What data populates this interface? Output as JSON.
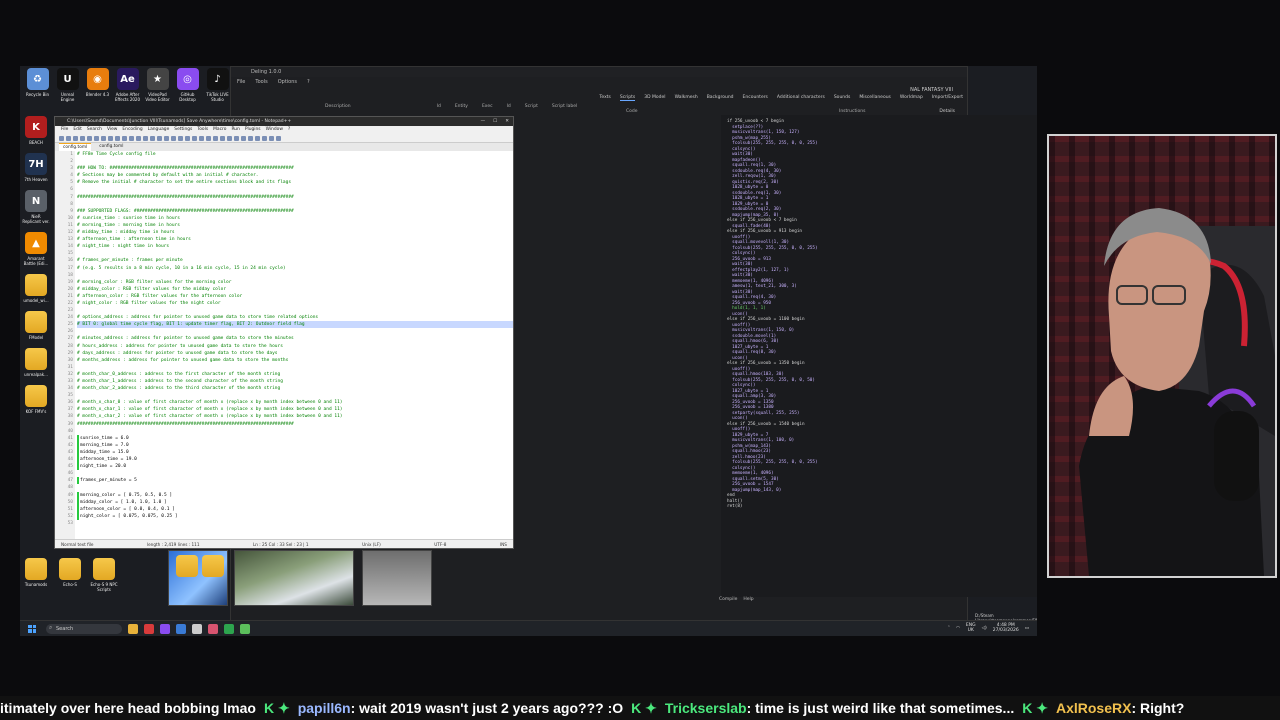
{
  "desktop": {
    "top_apps": [
      {
        "label": "Recycle Bin",
        "icon": "recycle-bin-icon",
        "color": "#5c8fd6",
        "glyph": "♻"
      },
      {
        "label": "Unreal Engine",
        "icon": "unreal-engine-icon",
        "color": "#111111",
        "glyph": "U"
      },
      {
        "label": "Blender 4.3",
        "icon": "blender-icon",
        "color": "#e87d0d",
        "glyph": "◉"
      },
      {
        "label": "Adobe After Effects 2020",
        "icon": "after-effects-icon",
        "color": "#2a1a5e",
        "glyph": "Ae"
      },
      {
        "label": "VideoPad Video Editor",
        "icon": "videopad-icon",
        "color": "#444444",
        "glyph": "★"
      },
      {
        "label": "GitHub Desktop",
        "icon": "github-icon",
        "color": "#8a4cf0",
        "glyph": "◎"
      },
      {
        "label": "TikTok LIVE Studio",
        "icon": "tiktok-icon",
        "color": "#111111",
        "glyph": "♪"
      }
    ],
    "left_icons": [
      {
        "label": "BEACH",
        "icon": "beach-app-icon",
        "color": "#b21e1e",
        "glyph": "K"
      },
      {
        "label": "7th Heaven",
        "icon": "seventh-heaven-icon",
        "color": "#20324f",
        "glyph": "7H"
      },
      {
        "label": "NieR Replicant ver.",
        "icon": "nier-icon",
        "color": "#5a6068",
        "glyph": "N"
      },
      {
        "label": "Amarant Battle (Edi...",
        "icon": "vlc-icon",
        "color": "#f08a00",
        "glyph": "▲"
      },
      {
        "label": "umodel_wi...",
        "icon": "folder-icon",
        "color": "folder",
        "glyph": ""
      },
      {
        "label": "FModel",
        "icon": "folder-icon",
        "color": "folder",
        "glyph": ""
      },
      {
        "label": "unrealpak...",
        "icon": "folder-icon",
        "color": "folder",
        "glyph": ""
      },
      {
        "label": "KOF FMV's",
        "icon": "folder-icon",
        "color": "folder",
        "glyph": ""
      }
    ],
    "bottom_icons": [
      {
        "label": "Tsunamods",
        "icon": "folder-icon"
      },
      {
        "label": "Echo-S",
        "icon": "folder-icon"
      },
      {
        "label": "Echo-S 9 NPC Scripts",
        "icon": "folder-icon"
      }
    ]
  },
  "toolwin": {
    "title": "Deling 1.0.0",
    "menu": [
      "File",
      "Tools",
      "Options",
      "?"
    ],
    "tabs": [
      "Texts",
      "Scripts",
      "3D Model",
      "Walkmesh",
      "Background",
      "Encounters",
      "Additional characters",
      "Sounds",
      "Miscellaneous",
      "Worldmap",
      "Import/Export"
    ],
    "active_tab": "Scripts",
    "right_title": "NAL FANTASY VIII",
    "column_headers": [
      "Description",
      "Id",
      "Entity",
      "Exec",
      "Id",
      "Script",
      "Script label"
    ],
    "code_header": "Code",
    "instructions_header": "Instructions",
    "details_label": "Details",
    "status_tabs": [
      "Compile",
      "Help"
    ],
    "path": "D:/Steam Library/steamapps/common/FINAL FANTASY VIII/Data/lang-en/field/fi"
  },
  "code_lines": [
    {
      "t": "if 256_uvoob < 7 begin",
      "c": "kw"
    },
    {
      "t": "  setplace(??)",
      "c": ""
    },
    {
      "t": "  musicvoltrans(1, 150, 127)",
      "c": ""
    },
    {
      "t": "  pshm_w(map_255)",
      "c": ""
    },
    {
      "t": "  fcolsub(255, 255, 255, 0, 0, 255)",
      "c": ""
    },
    {
      "t": "  colsync()",
      "c": ""
    },
    {
      "t": "  wait(30)",
      "c": ""
    },
    {
      "t": "  mapfadeon()",
      "c": ""
    },
    {
      "t": "  squall.req(1, 30)",
      "c": ""
    },
    {
      "t": "  ssdouble.req(4, 30)",
      "c": ""
    },
    {
      "t": "  zell.reqsw(1, 30)",
      "c": ""
    },
    {
      "t": "  quistis.req(2, 30)",
      "c": ""
    },
    {
      "t": "  1028_ubyte = 0",
      "c": ""
    },
    {
      "t": "  ssdouble.req(1, 30)",
      "c": ""
    },
    {
      "t": "  1028_ubyte = 1",
      "c": ""
    },
    {
      "t": "  1029_ubyte = 0",
      "c": ""
    },
    {
      "t": "  ssdouble.req(2, 30)",
      "c": ""
    },
    {
      "t": "  mapjump(map_35, 0)",
      "c": ""
    },
    {
      "t": "else if 256_uvoob < 7 begin",
      "c": "kw"
    },
    {
      "t": "  squall.fade(40)",
      "c": ""
    },
    {
      "t": "else if 256_uvoob = 913 begin",
      "c": "kw"
    },
    {
      "t": "  uooff()",
      "c": ""
    },
    {
      "t": "  squall.movevoll(1, 30)",
      "c": ""
    },
    {
      "t": "  fcolsub(255, 255, 255, 0, 0, 255)",
      "c": ""
    },
    {
      "t": "  colsync()",
      "c": ""
    },
    {
      "t": "  256_uvoob = 913",
      "c": ""
    },
    {
      "t": "  wait(30)",
      "c": ""
    },
    {
      "t": "  effectplay2(1, 127, 1)",
      "c": ""
    },
    {
      "t": "  wait(30)",
      "c": ""
    },
    {
      "t": "  memoeme(1, 4096)",
      "c": ""
    },
    {
      "t": "  amesw(1, text_21, 300, 3)",
      "c": ""
    },
    {
      "t": "  wait(30)",
      "c": ""
    },
    {
      "t": "  squall.req(4, 30)",
      "c": ""
    },
    {
      "t": "  256_uvoob = 950",
      "c": ""
    },
    {
      "t": "  hold(1, 1, 1)",
      "c": "ok"
    },
    {
      "t": "  ucon()",
      "c": ""
    },
    {
      "t": "else if 256_uvoob = 1100 begin",
      "c": "kw"
    },
    {
      "t": "  uooff()",
      "c": ""
    },
    {
      "t": "  musicvoltrans(1, 150, 0)",
      "c": ""
    },
    {
      "t": "  ssdouble.movel(1)",
      "c": ""
    },
    {
      "t": "  squall.hmoo(6, 30)",
      "c": ""
    },
    {
      "t": "  1027_ubyte = 1",
      "c": ""
    },
    {
      "t": "  squall.req(8, 30)",
      "c": ""
    },
    {
      "t": "  ucon()",
      "c": ""
    },
    {
      "t": "else if 256_uvoob = 1350 begin",
      "c": "kw"
    },
    {
      "t": "  uooff()",
      "c": ""
    },
    {
      "t": "  squall.hmoo(103, 30)",
      "c": ""
    },
    {
      "t": "  fcolsub(255, 255, 255, 0, 0, 50)",
      "c": ""
    },
    {
      "t": "  colsync()",
      "c": ""
    },
    {
      "t": "  1027_ubyte = 1",
      "c": ""
    },
    {
      "t": "  squall.amp(3, 30)",
      "c": ""
    },
    {
      "t": "  256_uvoob = 1350",
      "c": ""
    },
    {
      "t": "  256_uvoob = 1380",
      "c": ""
    },
    {
      "t": "  setparty(squall, 255, 255)",
      "c": ""
    },
    {
      "t": "  ucon()",
      "c": ""
    },
    {
      "t": "else if 256_uvoob = 1540 begin",
      "c": "kw"
    },
    {
      "t": "  uooff()",
      "c": ""
    },
    {
      "t": "  1029_ubyte = 7",
      "c": ""
    },
    {
      "t": "  musicvoltrans(1, 100, 0)",
      "c": ""
    },
    {
      "t": "  pshm_w(map_143)",
      "c": ""
    },
    {
      "t": "  squall.hmoo(23)",
      "c": ""
    },
    {
      "t": "  zell.hmoo(23)",
      "c": ""
    },
    {
      "t": "  fcolsub(255, 255, 255, 0, 0, 255)",
      "c": ""
    },
    {
      "t": "  colsync()",
      "c": ""
    },
    {
      "t": "  memoeme(1, 4096)",
      "c": ""
    },
    {
      "t": "  squall.setm(5, 30)",
      "c": ""
    },
    {
      "t": "  256_uvoob = 1547",
      "c": ""
    },
    {
      "t": "  mapjump(map_143, 0)",
      "c": ""
    },
    {
      "t": "end",
      "c": "kw"
    },
    {
      "t": "halt()",
      "c": "kw"
    },
    {
      "t": "ret(8)",
      "c": "kw"
    }
  ],
  "npp": {
    "title": "C:\\Users\\Sound\\Documents\\Junction VIII\\Tsunamods] Save Anywhere\\time\\config.toml - Notepad++",
    "menu": [
      "File",
      "Edit",
      "Search",
      "View",
      "Encoding",
      "Language",
      "Settings",
      "Tools",
      "Macro",
      "Run",
      "Plugins",
      "Window",
      "?"
    ],
    "tabs": [
      "config.toml",
      "config.toml"
    ],
    "status": {
      "type": "Normal text file",
      "length": "length : 2,419    lines : 111",
      "position": "Ln : 25    Col : 33    Sel : 23 | 1",
      "eol": "Unix (LF)",
      "encoding": "UTF-8",
      "mode": "INS"
    },
    "lines": [
      {
        "n": "1",
        "t": "# FF8e Time Cycle config file",
        "c": ""
      },
      {
        "n": "2",
        "t": "",
        "c": ""
      },
      {
        "n": "3",
        "t": "### HOW TO: ####################################################################",
        "c": ""
      },
      {
        "n": "4",
        "t": "# Sections may be commented by default with an initial # character.",
        "c": ""
      },
      {
        "n": "5",
        "t": "# Remove the initial # character to set the entire sections block and its flags",
        "c": ""
      },
      {
        "n": "6",
        "t": "",
        "c": ""
      },
      {
        "n": "7",
        "t": "################################################################################",
        "c": ""
      },
      {
        "n": "8",
        "t": "",
        "c": ""
      },
      {
        "n": "9",
        "t": "### SUPPORTED FLAGS: ###########################################################",
        "c": ""
      },
      {
        "n": "10",
        "t": "# sunrise_time : sunrise time in hours",
        "c": ""
      },
      {
        "n": "11",
        "t": "# morning_time : morning time in hours",
        "c": ""
      },
      {
        "n": "12",
        "t": "# midday_time : midday time in hours",
        "c": ""
      },
      {
        "n": "13",
        "t": "# afternoon_time : afternoon time in hours",
        "c": ""
      },
      {
        "n": "14",
        "t": "# night_time : night time in hours",
        "c": ""
      },
      {
        "n": "15",
        "t": "",
        "c": ""
      },
      {
        "n": "16",
        "t": "# frames_per_minute : frames per minute",
        "c": ""
      },
      {
        "n": "17",
        "t": "# (e.g. 5 results in a 8 min cycle, 10 in a 16 min cycle, 15 in 24 min cycle)",
        "c": ""
      },
      {
        "n": "18",
        "t": "",
        "c": ""
      },
      {
        "n": "19",
        "t": "# morning_color : RGB filter values for the morning color",
        "c": ""
      },
      {
        "n": "20",
        "t": "# midday_color : RGB filter values for the midday color",
        "c": ""
      },
      {
        "n": "21",
        "t": "# afternoon_color : RGB filter values for the afternoon color",
        "c": ""
      },
      {
        "n": "22",
        "t": "# night_color : RGB filter values for the night color",
        "c": ""
      },
      {
        "n": "23",
        "t": "",
        "c": ""
      },
      {
        "n": "24",
        "t": "# options_address : address for pointer to unused game data to store time related options",
        "c": ""
      },
      {
        "n": "25",
        "t": "# BIT 0: global time cycle flag, BIT 1: update timer flag, BIT 2: Outdoor field flag",
        "c": "hl"
      },
      {
        "n": "26",
        "t": "",
        "c": ""
      },
      {
        "n": "27",
        "t": "# minutes_address : address for pointer to unused game data to store the minutes",
        "c": ""
      },
      {
        "n": "28",
        "t": "# hours_address : address for pointer to unused game data to store the hours",
        "c": ""
      },
      {
        "n": "29",
        "t": "# days_address : address for pointer to unused game data to store the days",
        "c": ""
      },
      {
        "n": "30",
        "t": "# months_address : address for pointer to unused game data to store the months",
        "c": ""
      },
      {
        "n": "31",
        "t": "",
        "c": ""
      },
      {
        "n": "32",
        "t": "# month_char_0_address : address to the first character of the month string",
        "c": ""
      },
      {
        "n": "33",
        "t": "# month_char_1_address : address to the second character of the month string",
        "c": ""
      },
      {
        "n": "34",
        "t": "# month_char_2_address : address to the third character of the month string",
        "c": ""
      },
      {
        "n": "35",
        "t": "",
        "c": ""
      },
      {
        "n": "36",
        "t": "# month_x_char_0 : value of first character of month x (replace x by month index between 0 and 11)",
        "c": ""
      },
      {
        "n": "37",
        "t": "# month_x_char_1 : value of first character of month x (replace x by month index between 0 and 11)",
        "c": ""
      },
      {
        "n": "38",
        "t": "# month_x_char_2 : value of first character of month x (replace x by month index between 0 and 11)",
        "c": ""
      },
      {
        "n": "39",
        "t": "################################################################################",
        "c": ""
      },
      {
        "n": "40",
        "t": "",
        "c": ""
      },
      {
        "n": "41",
        "t": "sunrise_time = 6.0",
        "c": "code bar"
      },
      {
        "n": "42",
        "t": "morning_time = 7.0",
        "c": "code bar"
      },
      {
        "n": "43",
        "t": "midday_time = 15.0",
        "c": "code bar"
      },
      {
        "n": "44",
        "t": "afternoon_time = 19.0",
        "c": "code bar"
      },
      {
        "n": "45",
        "t": "night_time = 20.0",
        "c": "code bar"
      },
      {
        "n": "46",
        "t": "",
        "c": ""
      },
      {
        "n": "47",
        "t": "frames_per_minute = 5",
        "c": "code bar"
      },
      {
        "n": "48",
        "t": "",
        "c": ""
      },
      {
        "n": "49",
        "t": "morning_color = [ 0.75, 0.5, 0.5 ]",
        "c": "code bar"
      },
      {
        "n": "50",
        "t": "midday_color = [ 1.0, 1.0, 1.0 ]",
        "c": "code bar"
      },
      {
        "n": "51",
        "t": "afternoon_color = [ 0.0, 0.4, 0.1 ]",
        "c": "code bar"
      },
      {
        "n": "52",
        "t": "night_color = [ 0.075, 0.075, 0.25 ]",
        "c": "code bar"
      },
      {
        "n": "53",
        "t": "",
        "c": ""
      }
    ]
  },
  "taskbar": {
    "search_placeholder": "Search",
    "apps": [
      "#e8b23a",
      "#d83b3b",
      "#8a4cf0",
      "#3a7bd5",
      "#cccccc",
      "#d8546f",
      "#2da44e",
      "#5cbf5c"
    ],
    "lang": "ENG",
    "region": "UK",
    "time": "4:48 PM",
    "date": "27/03/2026"
  },
  "ticker": [
    {
      "kind": "msg",
      "text": "itimately over here head bobbing lmao"
    },
    {
      "kind": "sep",
      "text": "K ✦"
    },
    {
      "kind": "user",
      "text": "papill6n",
      "color": "#9ab8ff"
    },
    {
      "kind": "msg",
      "text": ": wait 2019 wasn't just 2 years ago??? :O"
    },
    {
      "kind": "sep",
      "text": "K ✦"
    },
    {
      "kind": "user",
      "text": "Trickserslab",
      "color": "#4be87d"
    },
    {
      "kind": "msg",
      "text": ": time is just weird like that sometimes..."
    },
    {
      "kind": "sep",
      "text": "K ✦"
    },
    {
      "kind": "user",
      "text": "AxlRoseRX",
      "color": "#f2c14e"
    },
    {
      "kind": "msg",
      "text": ": Right?"
    }
  ]
}
